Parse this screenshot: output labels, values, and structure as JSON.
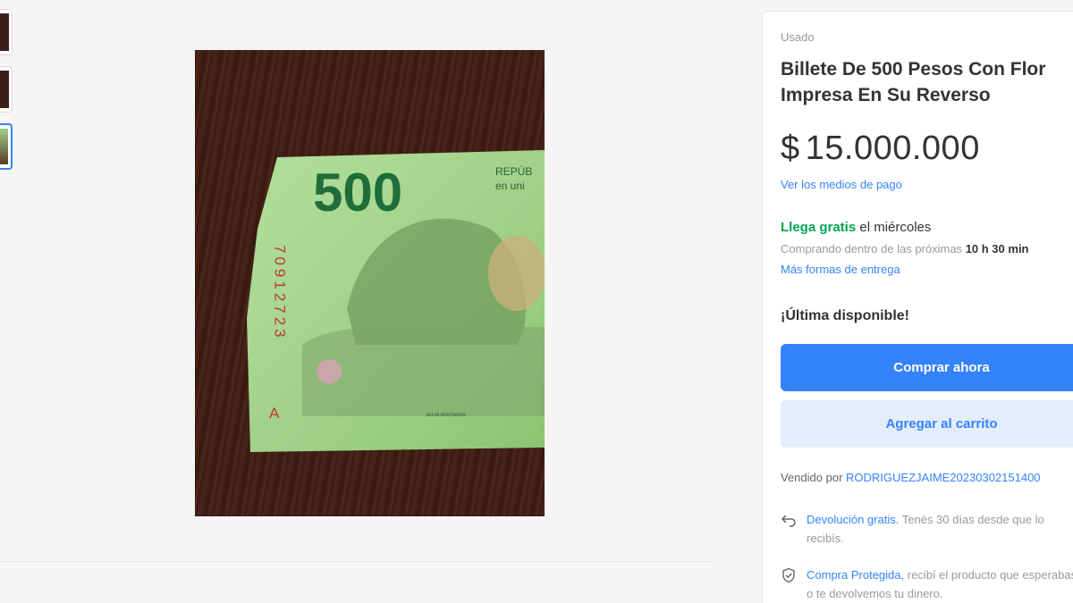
{
  "gallery": {
    "thumbnail_count": 3,
    "active_thumbnail": 3,
    "photo_banknote": {
      "denomination": "500",
      "header_line1": "REPÚB",
      "header_line2": "en uni",
      "serial": "70912723",
      "serial_letter": "A",
      "small_text": "SELVA MISIONERA"
    }
  },
  "listing": {
    "condition": "Usado",
    "title": "Billete De 500 Pesos Con Flor Impresa En Su Reverso",
    "currency_symbol": "$",
    "price": "15.000.000",
    "payment_link": "Ver los medios de pago",
    "shipping_highlight": "Llega gratis",
    "shipping_day": "el miércoles",
    "shipping_condition_prefix": "Comprando dentro de las próximas",
    "shipping_countdown": "10 h 30 min",
    "more_shipping_link": "Más formas de entrega",
    "stock_label": "¡Última disponible!",
    "buy_button": "Comprar ahora",
    "cart_button": "Agregar al carrito",
    "seller_prefix": "Vendido por",
    "seller_name": "RODRIGUEZJAIME20230302151400",
    "returns_link": "Devolución gratis.",
    "returns_text": "Tenés 30 días desde que lo recibís.",
    "protected_link": "Compra Protegida,",
    "protected_text": "recibí el producto que esperabas o te devolvemos tu dinero."
  },
  "colors": {
    "accent": "#3483fa",
    "shipping_green": "#00a650",
    "note_green": "#a3d68e"
  }
}
